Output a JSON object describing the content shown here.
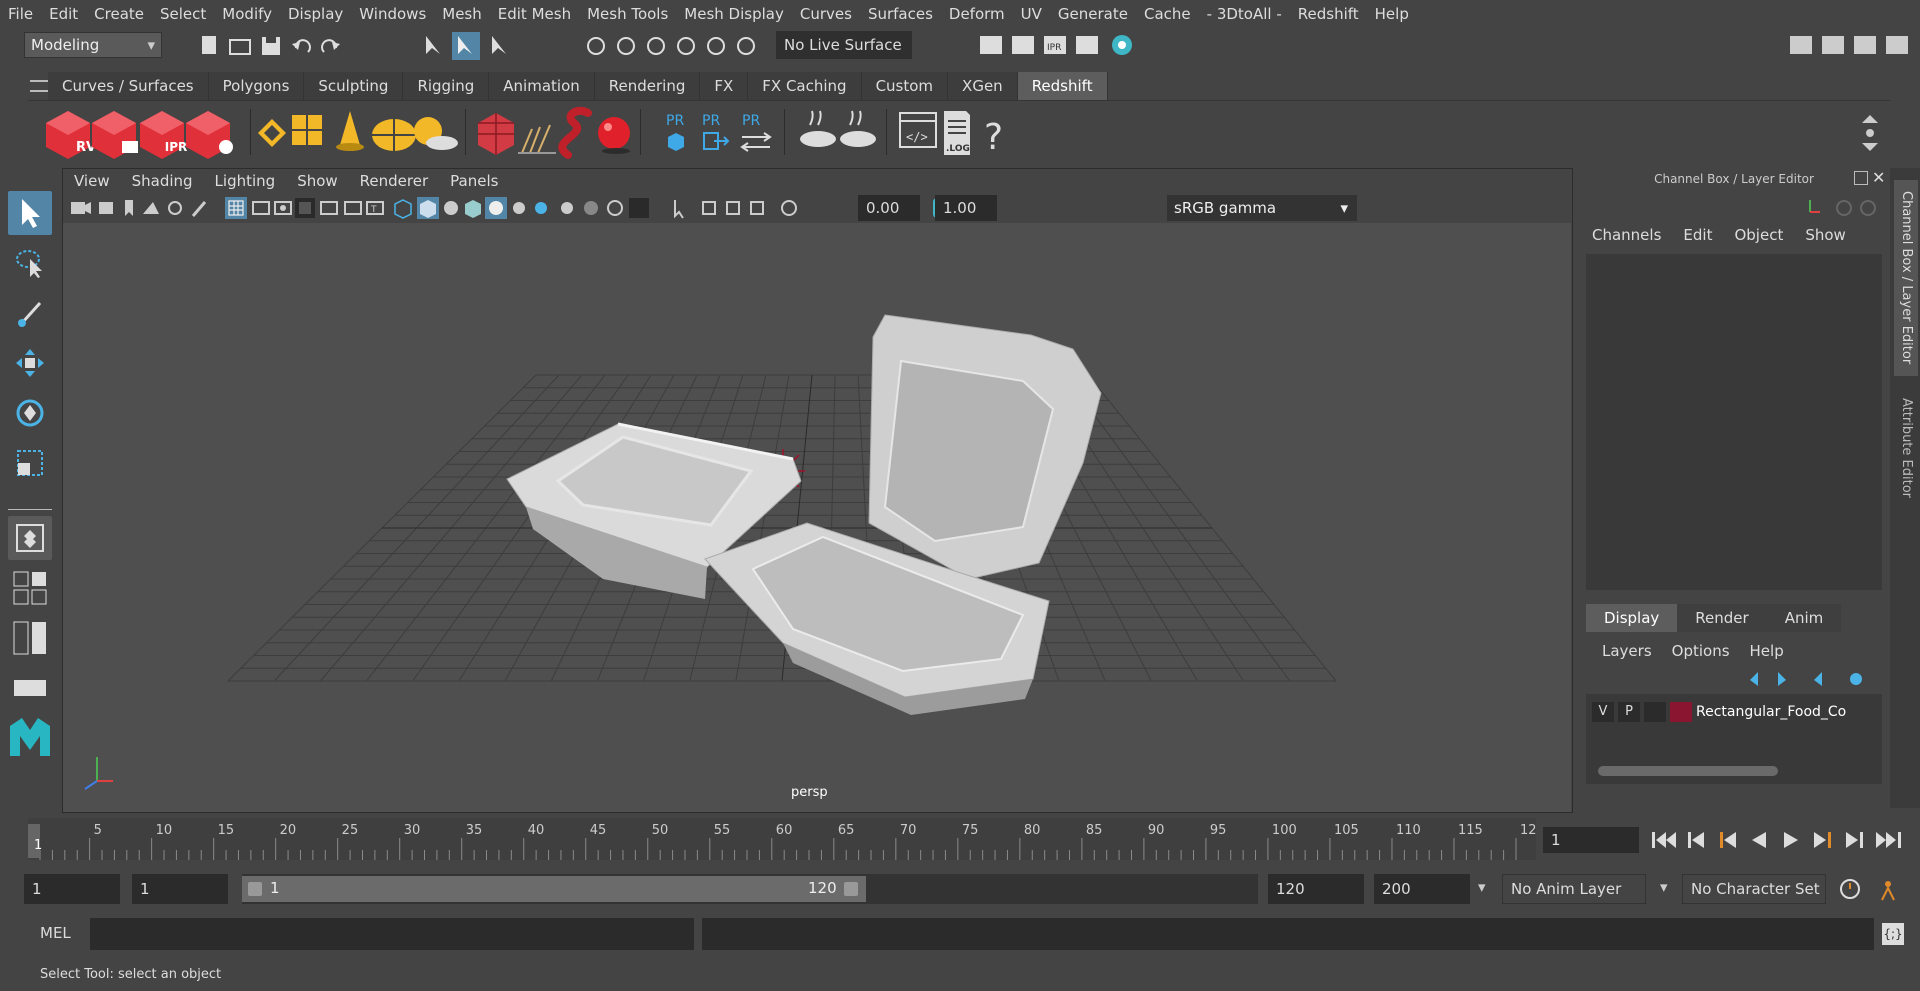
{
  "menubar": {
    "items": [
      "File",
      "Edit",
      "Create",
      "Select",
      "Modify",
      "Display",
      "Windows",
      "Mesh",
      "Edit Mesh",
      "Mesh Tools",
      "Mesh Display",
      "Curves",
      "Surfaces",
      "Deform",
      "UV",
      "Generate",
      "Cache",
      "- 3DtoAll -",
      "Redshift",
      "Help"
    ]
  },
  "statusline": {
    "workspace": "Modeling",
    "live_surface": "No Live Surface"
  },
  "shelf": {
    "tabs": [
      "Curves / Surfaces",
      "Polygons",
      "Sculpting",
      "Rigging",
      "Animation",
      "Rendering",
      "FX",
      "FX Caching",
      "Custom",
      "XGen",
      "Redshift"
    ],
    "active_tab": "Redshift",
    "rs_labels": [
      "RV",
      "IPR",
      "PR",
      "PR",
      "PR"
    ],
    "log_label": ".LOG",
    "help_glyph": "?"
  },
  "viewport": {
    "menu": [
      "View",
      "Shading",
      "Lighting",
      "Show",
      "Renderer",
      "Panels"
    ],
    "exposure": "0.00",
    "gamma": "1.00",
    "colorspace": "sRGB gamma",
    "camera_label": "persp"
  },
  "channel_box": {
    "title": "Channel Box / Layer Editor",
    "menu": [
      "Channels",
      "Edit",
      "Object",
      "Show"
    ]
  },
  "layer_editor": {
    "tabs": [
      "Display",
      "Render",
      "Anim"
    ],
    "active_tab": "Display",
    "menu": [
      "Layers",
      "Options",
      "Help"
    ],
    "layer": {
      "v": "V",
      "p": "P",
      "name": "Rectangular_Food_Co",
      "color": "#8a1530"
    }
  },
  "side_tabs": [
    "Channel Box / Layer Editor",
    "Attribute Editor"
  ],
  "timeline": {
    "ticks": [
      "5",
      "10",
      "15",
      "20",
      "25",
      "30",
      "35",
      "40",
      "45",
      "50",
      "55",
      "60",
      "65",
      "70",
      "75",
      "80",
      "85",
      "90",
      "95",
      "100",
      "105",
      "110",
      "115",
      "12"
    ],
    "current_frame": "1",
    "start_label": "1"
  },
  "range": {
    "start": "1",
    "playback_start": "1",
    "slider_start": "1",
    "slider_end": "120",
    "playback_end": "120",
    "end": "200",
    "anim_layer": "No Anim Layer",
    "character_set": "No Character Set"
  },
  "command": {
    "label": "MEL"
  },
  "help_line": "Select Tool: select an object"
}
